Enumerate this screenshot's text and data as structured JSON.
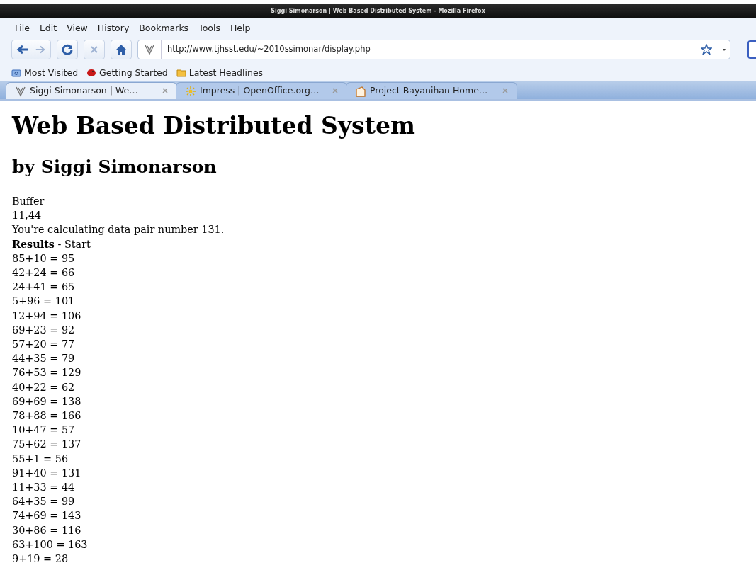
{
  "window": {
    "title": "Siggi Simonarson | Web Based Distributed System - Mozilla Firefox"
  },
  "menu": [
    "File",
    "Edit",
    "View",
    "History",
    "Bookmarks",
    "Tools",
    "Help"
  ],
  "address_bar": {
    "url": "http://www.tjhsst.edu/~2010ssimonar/display.php"
  },
  "bookmarks": [
    {
      "label": "Most Visited",
      "kind": "smart"
    },
    {
      "label": "Getting Started",
      "kind": "firefox"
    },
    {
      "label": "Latest Headlines",
      "kind": "feed"
    }
  ],
  "tabs": [
    {
      "label": "Siggi Simonarson | We…",
      "selected": true,
      "kind": "site"
    },
    {
      "label": "Impress | OpenOffice.org…",
      "selected": false,
      "kind": "impress"
    },
    {
      "label": "Project Bayanihan Home…",
      "selected": false,
      "kind": "page"
    }
  ],
  "page": {
    "heading": "Web Based Distributed System",
    "subheading": "by Siggi Simonarson",
    "lines": [
      "Buffer",
      "11,44",
      "You're calculating data pair number 131.",
      "**Results** - Start",
      "85+10 = 95",
      "42+24 = 66",
      "24+41 = 65",
      "5+96 = 101",
      "12+94 = 106",
      "69+23 = 92",
      "57+20 = 77",
      "44+35 = 79",
      "76+53 = 129",
      "40+22 = 62",
      "69+69 = 138",
      "78+88 = 166",
      "10+47 = 57",
      "75+62 = 137",
      "55+1 = 56",
      "91+40 = 131",
      "11+33 = 44",
      "64+35 = 99",
      "74+69 = 143",
      "30+86 = 116",
      "63+100 = 163",
      "9+19 = 28"
    ]
  }
}
